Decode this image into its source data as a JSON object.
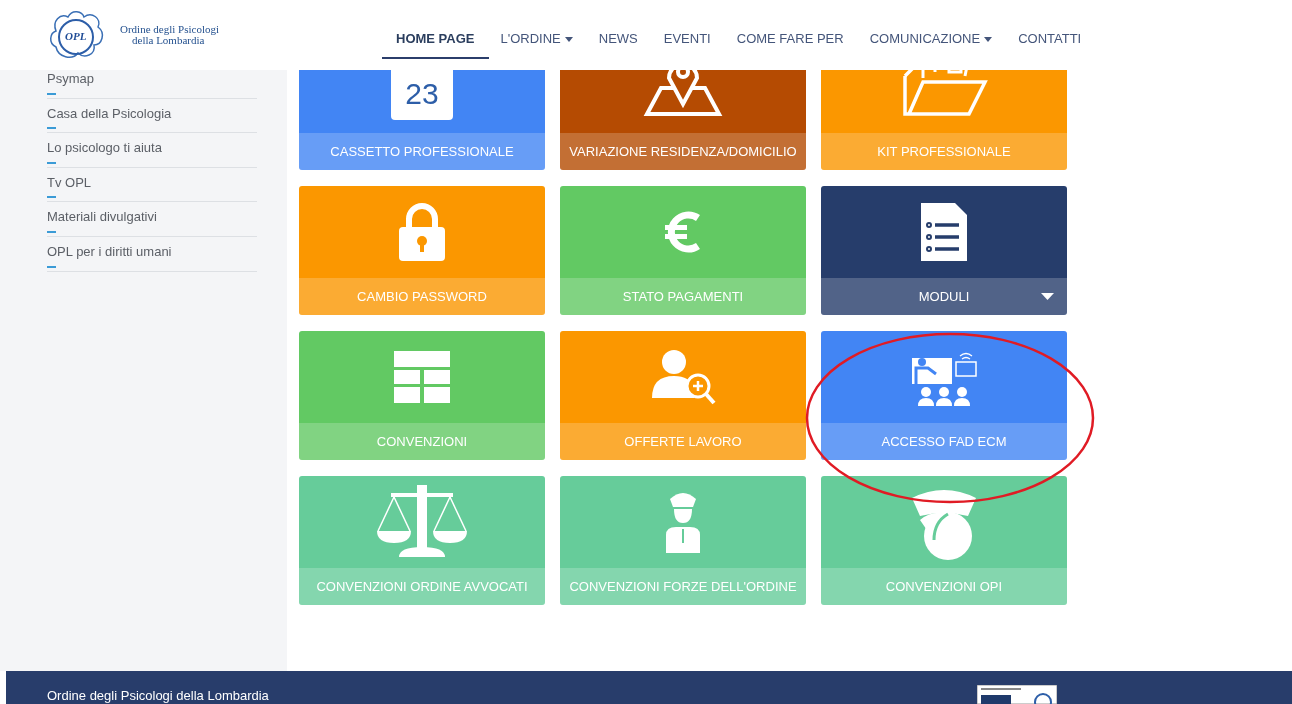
{
  "logo": {
    "line_1": "Ordine degli Psicologi",
    "line_2": "della Lombardia",
    "mark": "OPL"
  },
  "nav": [
    {
      "label": "HOME PAGE",
      "selected": true,
      "dropdown": false
    },
    {
      "label": "L'ORDINE",
      "selected": false,
      "dropdown": true
    },
    {
      "label": "NEWS",
      "selected": false,
      "dropdown": false
    },
    {
      "label": "EVENTI",
      "selected": false,
      "dropdown": false
    },
    {
      "label": "COME FARE PER",
      "selected": false,
      "dropdown": false
    },
    {
      "label": "COMUNICAZIONE",
      "selected": false,
      "dropdown": true
    },
    {
      "label": "CONTATTI",
      "selected": false,
      "dropdown": false
    }
  ],
  "sidebar": {
    "items": [
      "Psymap",
      "Casa della Psicologia",
      "Lo psicologo ti aiuta",
      "Tv OPL",
      "Materiali divulgativi",
      "OPL per i diritti umani"
    ]
  },
  "tiles": [
    {
      "label": "CASSETTO PROFESSIONALE",
      "kind": "calendar",
      "color": "#4285f4",
      "day": "23",
      "dropdown": false
    },
    {
      "label": "VARIAZIONE RESIDENZA/DOMICILIO",
      "kind": "map",
      "color": "#b54b02",
      "dropdown": false
    },
    {
      "label": "KIT PROFESSIONALE",
      "kind": "folder",
      "color": "#fb9700",
      "dropdown": false
    },
    {
      "label": "CAMBIO PASSWORD",
      "kind": "lock",
      "color": "#fb9700",
      "dropdown": false
    },
    {
      "label": "STATO PAGAMENTI",
      "kind": "euro",
      "color": "#62c963",
      "dropdown": false
    },
    {
      "label": "MODULI",
      "kind": "document",
      "color": "#263d6b",
      "dropdown": true
    },
    {
      "label": "CONVENZIONI",
      "kind": "grid",
      "color": "#62c963",
      "dropdown": false
    },
    {
      "label": "OFFERTE LAVORO",
      "kind": "person-search",
      "color": "#fb9700",
      "dropdown": false
    },
    {
      "label": "ACCESSO FAD ECM",
      "kind": "classroom",
      "color": "#4285f4",
      "dropdown": false
    },
    {
      "label": "CONVENZIONI ORDINE AVVOCATI",
      "kind": "scales",
      "color": "#66cc9a",
      "dropdown": false
    },
    {
      "label": "CONVENZIONI FORZE DELL'ORDINE",
      "kind": "officer",
      "color": "#66cc9a",
      "dropdown": false
    },
    {
      "label": "CONVENZIONI OPI",
      "kind": "nurse",
      "color": "#66cc9a",
      "dropdown": false
    }
  ],
  "footer": {
    "text": "Ordine degli Psicologi della Lombardia"
  }
}
